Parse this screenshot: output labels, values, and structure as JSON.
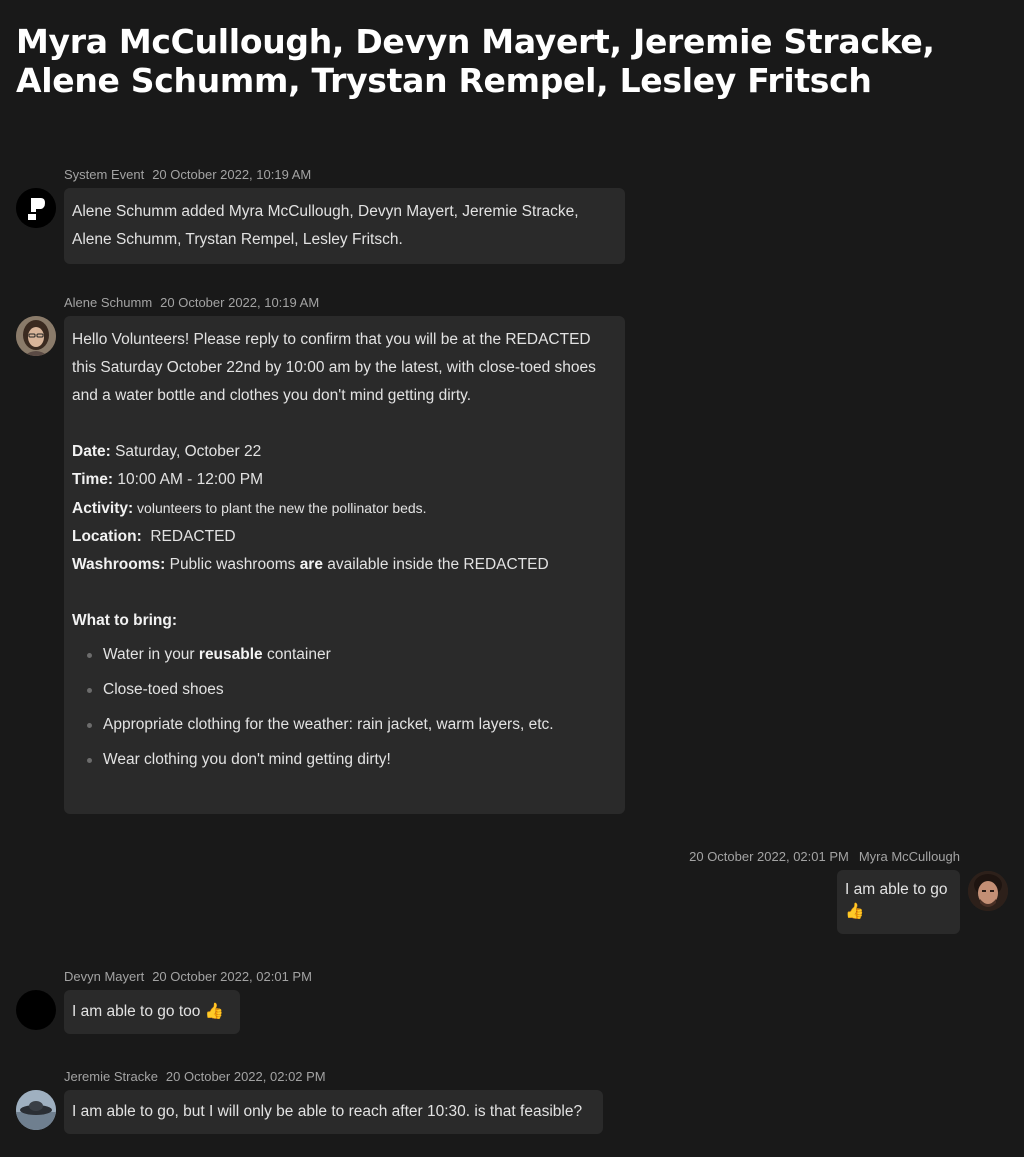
{
  "conversation": {
    "title": "Myra McCullough, Devyn Mayert, Jeremie Stracke, Alene Schumm, Trystan Rempel, Lesley Fritsch"
  },
  "messages": [
    {
      "sender": "System Event",
      "timestamp": "20 October 2022, 10:19 AM",
      "text": "Alene Schumm added Myra McCullough, Devyn Mayert, Jeremie Stracke, Alene Schumm, Trystan Rempel, Lesley Fritsch."
    },
    {
      "sender": "Alene Schumm",
      "timestamp": "20 October 2022, 10:19 AM",
      "intro": "Hello Volunteers! Please reply to confirm that you will be at the REDACTED this Saturday October 22nd by 10:00 am by the latest, with close-toed shoes and a water bottle and clothes you don't mind getting dirty.",
      "details": {
        "date_label": "Date:",
        "date_value": " Saturday, October 22",
        "time_label": "Time:",
        "time_value": " 10:00 AM - 12:00 PM",
        "activity_label": "Activity:",
        "activity_value": " volunteers to plant the new the pollinator beds.",
        "location_label": "Location:",
        "location_value": "  REDACTED",
        "washrooms_label": "Washrooms:",
        "washrooms_value_1": " Public washrooms ",
        "washrooms_value_bold": "are",
        "washrooms_value_2": " available inside the REDACTED"
      },
      "bring_heading": "What to bring:",
      "bring_items": {
        "item1_pre": "Water in your ",
        "item1_bold": "reusable",
        "item1_post": " container",
        "item2": "Close-toed shoes",
        "item3": "Appropriate clothing for the weather: rain jacket, warm layers, etc.",
        "item4": "Wear clothing you don't mind getting dirty!"
      }
    },
    {
      "sender": "Myra McCullough",
      "timestamp": "20 October 2022, 02:01 PM",
      "text_line1": "I am able to go",
      "emoji": "👍"
    },
    {
      "sender": "Devyn Mayert",
      "timestamp": "20 October 2022, 02:01 PM",
      "text": "I am able to go too",
      "emoji": "👍"
    },
    {
      "sender": "Jeremie Stracke",
      "timestamp": "20 October 2022, 02:02 PM",
      "text": "I am able to go, but I will only be able to reach after 10:30. is that feasible?"
    }
  ],
  "colors": {
    "background": "#191919",
    "bubble": "#2a2a2a",
    "meta_text": "#a3a3a3"
  }
}
